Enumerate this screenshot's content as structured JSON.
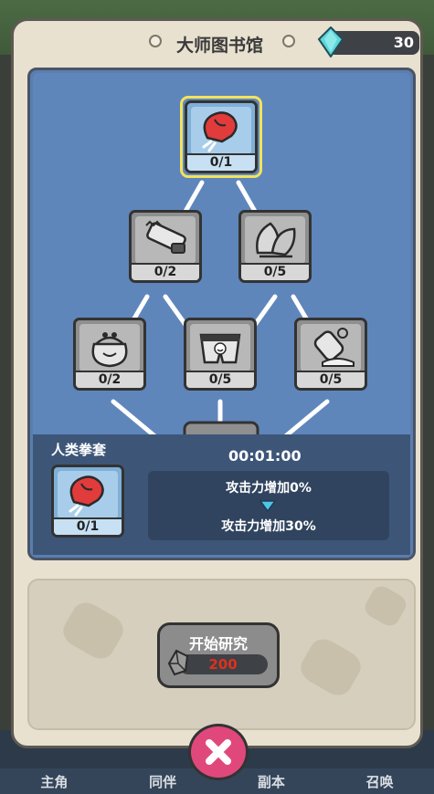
{
  "header": {
    "title": "大师图书馆",
    "gem_count": "30"
  },
  "tree": {
    "nodes": [
      {
        "id": "boxing-glove",
        "icon": "boxing-glove-icon",
        "count": "0/1",
        "selected": true
      },
      {
        "id": "chainsaw",
        "icon": "chainsaw-icon",
        "count": "0/2",
        "selected": false
      },
      {
        "id": "fan",
        "icon": "folding-fan-icon",
        "count": "0/5",
        "selected": false
      },
      {
        "id": "pouch",
        "icon": "coin-pouch-icon",
        "count": "0/2",
        "selected": false
      },
      {
        "id": "shorts",
        "icon": "smiley-shorts-icon",
        "count": "0/5",
        "selected": false
      },
      {
        "id": "bottle",
        "icon": "spilled-bottle-icon",
        "count": "0/5",
        "selected": false
      }
    ]
  },
  "info": {
    "name": "人类拳套",
    "timer": "00:01:00",
    "card_count": "0/1",
    "effect_current": "攻击力增加0%",
    "effect_next": "攻击力增加30%"
  },
  "research": {
    "button_label": "开始研究",
    "cost": "200"
  },
  "bottom_nav": [
    "主角",
    "同伴",
    "副本",
    "召唤"
  ],
  "colors": {
    "accent_yellow": "#f3e35a",
    "cost_red": "#e0301e",
    "close_pink": "#e0487c"
  }
}
